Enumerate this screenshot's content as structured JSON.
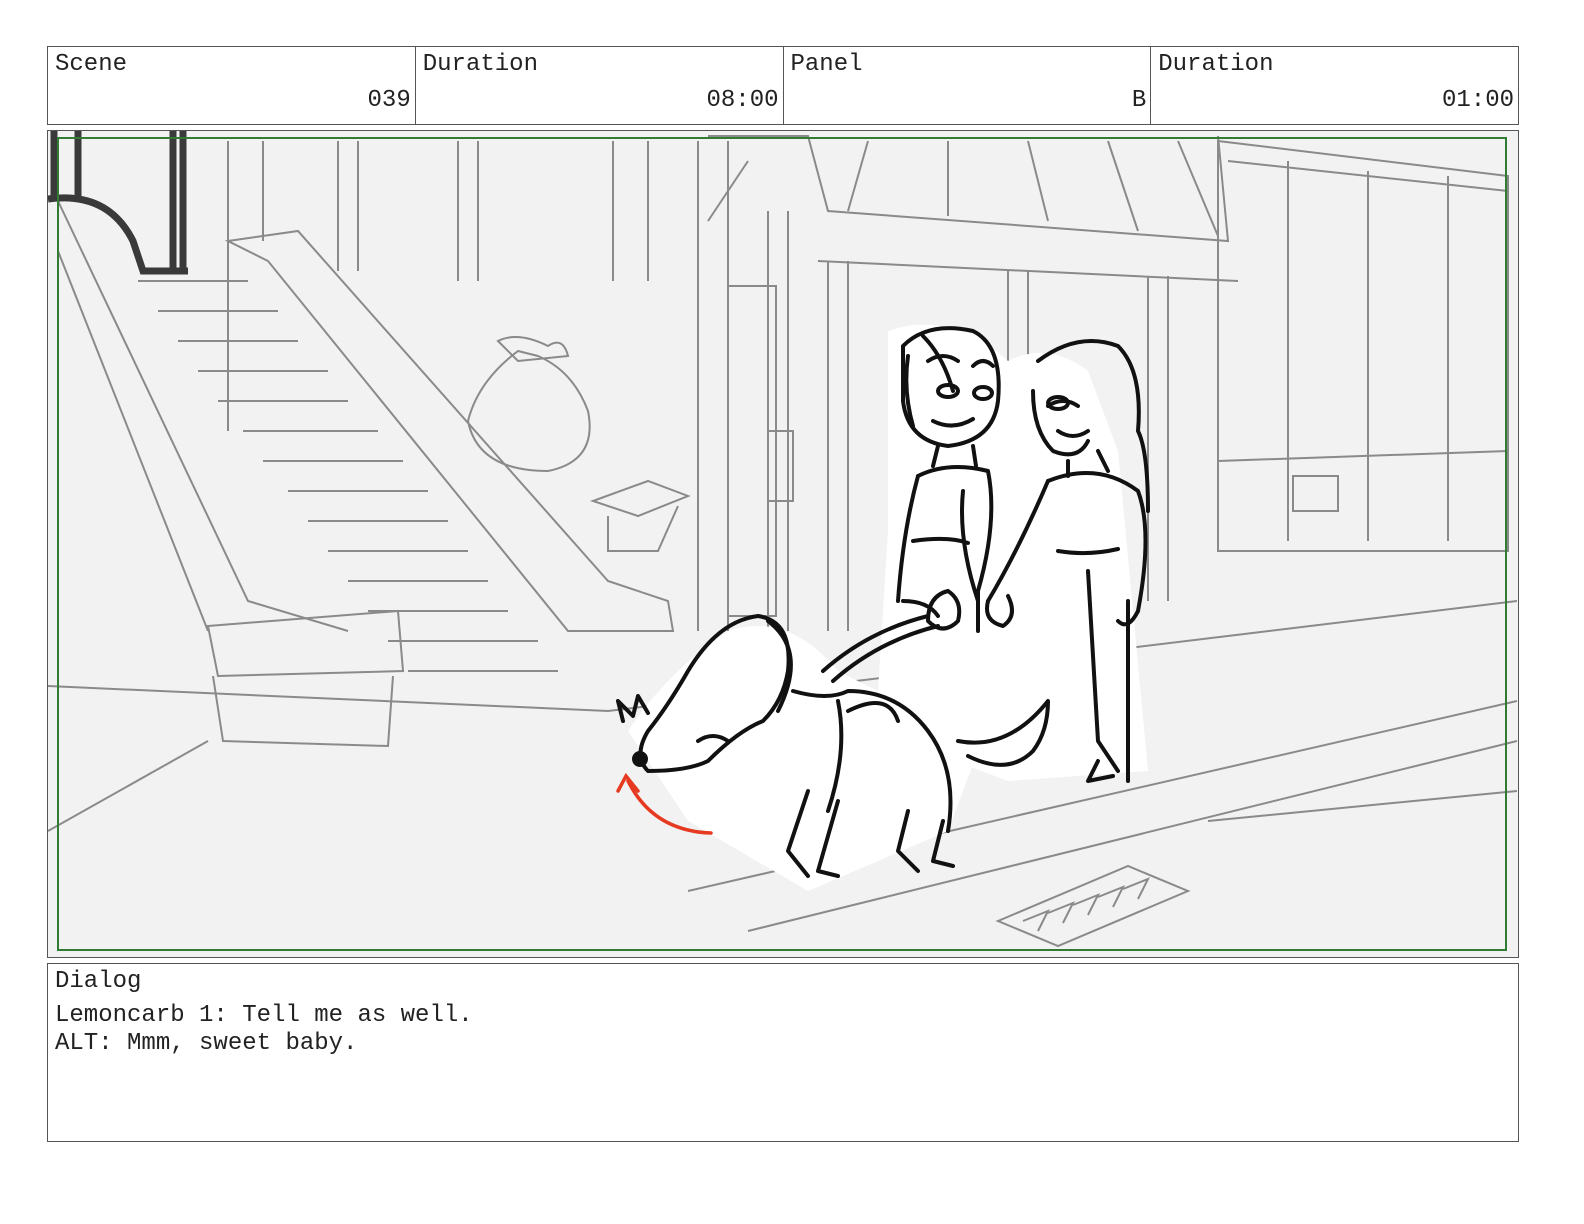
{
  "header": {
    "scene_label": "Scene",
    "scene_value": "039",
    "duration_label": "Duration",
    "duration_value": "08:00",
    "panel_label": "Panel",
    "panel_value": "B",
    "panel_duration_label": "Duration",
    "panel_duration_value": "01:00"
  },
  "dialog": {
    "label": "Dialog",
    "lines": [
      "Lemoncarb 1: Tell me as well.",
      "ALT: Mmm, sweet baby."
    ]
  },
  "colors": {
    "safe_frame": "#2e7d32",
    "motion_arrow": "#e53920",
    "border": "#555555"
  }
}
